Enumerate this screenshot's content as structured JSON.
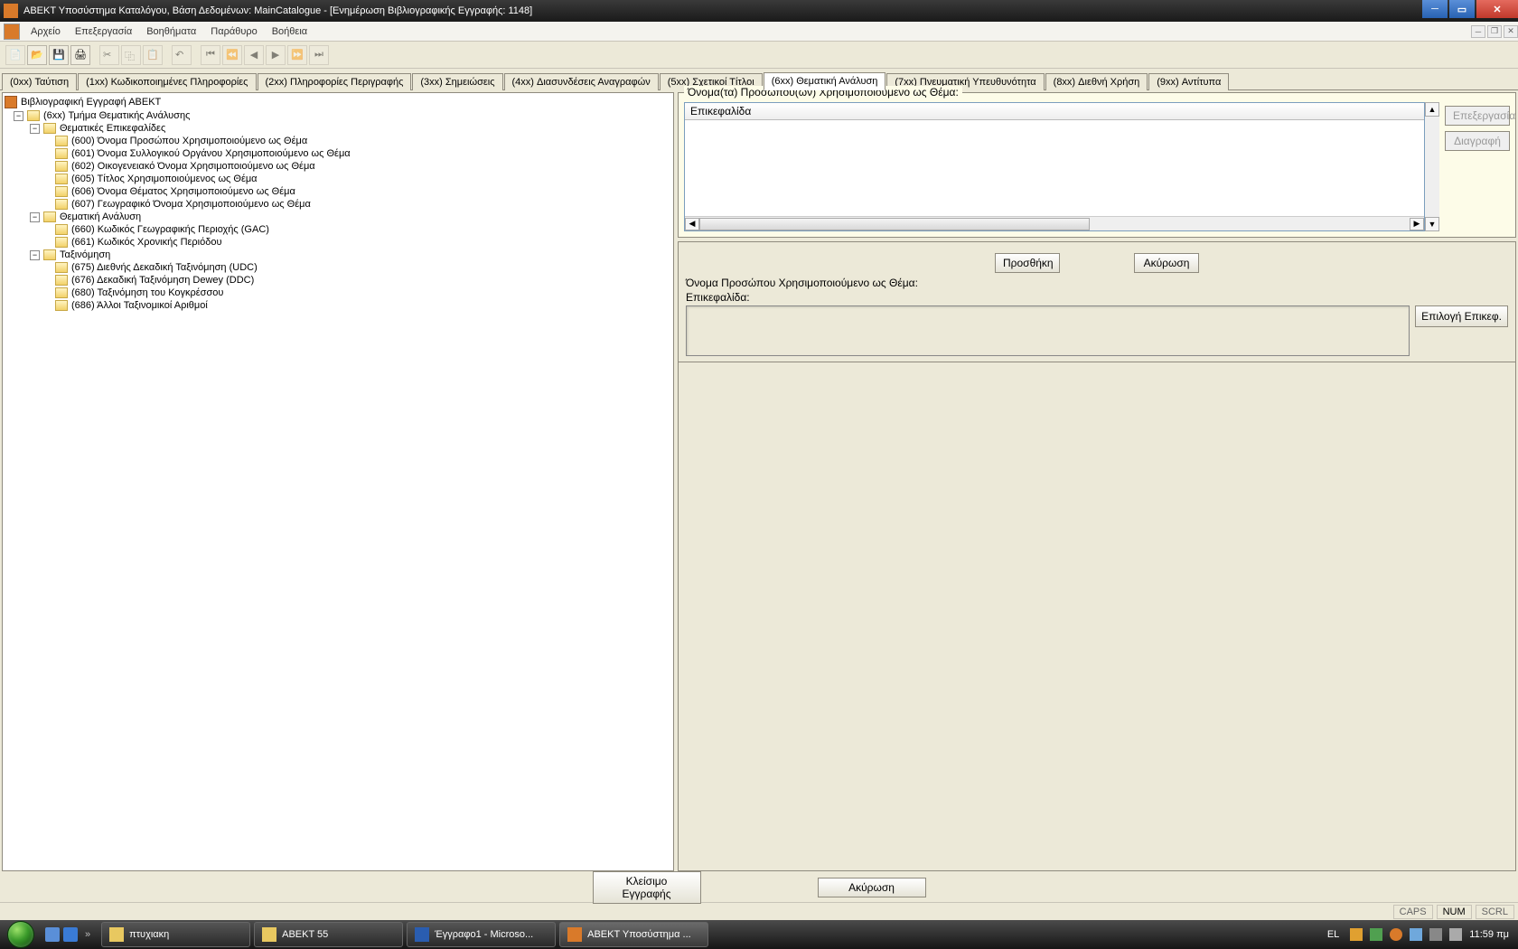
{
  "titlebar": {
    "text": "ΑΒΕΚΤ Υποσύστημα Καταλόγου, Βάση Δεδομένων: MainCatalogue - [Ενημέρωση Βιβλιογραφικής Εγγραφής: 1148]"
  },
  "menubar": {
    "items": [
      "Αρχείο",
      "Επεξεργασία",
      "Βοηθήματα",
      "Παράθυρο",
      "Βοήθεια"
    ]
  },
  "tabs": [
    "(0xx) Ταύτιση",
    "(1xx) Κωδικοποιημένες Πληροφορίες",
    "(2xx) Πληροφορίες Περιγραφής",
    "(3xx) Σημειώσεις",
    "(4xx) Διασυνδέσεις Αναγραφών",
    "(5xx) Σχετικοί Τίτλοι",
    "(6xx) Θεματική Ανάλυση",
    "(7xx) Πνευματική Υπευθυνότητα",
    "(8xx) Διεθνή Χρήση",
    "(9xx) Αντίτυπα"
  ],
  "active_tab_index": 6,
  "tree": {
    "root": "Βιβλιογραφική Εγγραφή ΑΒΕΚΤ",
    "section": "(6xx) Τμήμα Θεματικής Ανάλυσης",
    "groups": [
      {
        "label": "Θεματικές Επικεφαλίδες",
        "items": [
          "(600) Όνομα Προσώπου Χρησιμοποιούμενο ως Θέμα",
          "(601) Όνομα Συλλογικού Οργάνου Χρησιμοποιούμενο ως Θέμα",
          "(602) Οικογενειακό Όνομα Χρησιμοποιούμενο ως Θέμα",
          "(605) Τίτλος Χρησιμοποιούμενος ως Θέμα",
          "(606) Όνομα Θέματος Χρησιμοποιούμενο ως Θέμα",
          "(607) Γεωγραφικό Όνομα Χρησιμοποιούμενο ως Θέμα"
        ]
      },
      {
        "label": "Θεματική Ανάλυση",
        "items": [
          "(660) Κωδικός Γεωγραφικής Περιοχής (GAC)",
          "(661) Κωδικός Χρονικής Περιόδου"
        ]
      },
      {
        "label": "Ταξινόμηση",
        "items": [
          "(675) Διεθνής Δεκαδική Ταξινόμηση (UDC)",
          "(676) Δεκαδική Ταξινόμηση Dewey (DDC)",
          "(680) Ταξινόμηση του Κογκρέσσου",
          "(686) Άλλοι Ταξινομικοί Αριθμοί"
        ]
      }
    ]
  },
  "right": {
    "groupbox_title": "Όνομα(τα) Προσώπου(ων) Χρησιμοποιούμενο ως Θέμα:",
    "list_header": "Επικεφαλίδα",
    "btn_edit": "Επεξεργασία",
    "btn_delete": "Διαγραφή",
    "btn_add": "Προσθήκη",
    "btn_cancel": "Ακύρωση",
    "mid_label1": "Όνομα Προσώπου Χρησιμοποιούμενο ως Θέμα:",
    "mid_label2": "Επικεφαλίδα:",
    "btn_select_head": "Επιλογή Επικεφ."
  },
  "bottom": {
    "close_record": "Κλείσιμο Εγγραφής",
    "cancel": "Ακύρωση"
  },
  "status": {
    "caps": "CAPS",
    "num": "NUM",
    "scrl": "SCRL"
  },
  "taskbar": {
    "items": [
      {
        "label": "πτυχιακη"
      },
      {
        "label": "ABEKT 55"
      },
      {
        "label": "Έγγραφο1 - Microso..."
      },
      {
        "label": "ΑΒΕΚΤ Υποσύστημα ..."
      }
    ],
    "lang": "EL",
    "time": "11:59 πμ"
  }
}
